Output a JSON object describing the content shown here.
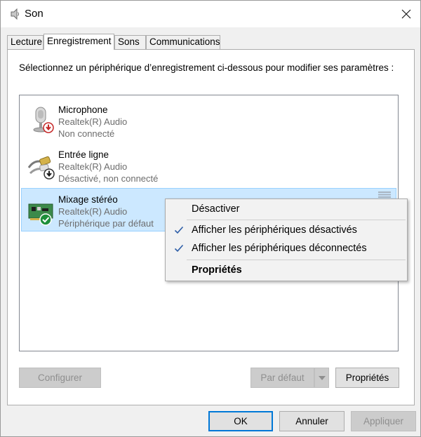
{
  "window": {
    "title": "Son",
    "icon": "speaker-icon",
    "close_icon": "close-icon"
  },
  "tabs": [
    {
      "label": "Lecture"
    },
    {
      "label": "Enregistrement",
      "active": true
    },
    {
      "label": "Sons"
    },
    {
      "label": "Communications"
    }
  ],
  "panel": {
    "instruction": "Sélectionnez un périphérique d’enregistrement ci-dessous pour modifier ses paramètres :"
  },
  "devices": [
    {
      "name": "Microphone",
      "driver": "Realtek(R) Audio",
      "status": "Non connecté",
      "icon": "microphone-icon",
      "badge": "disconnected-badge-icon"
    },
    {
      "name": "Entrée ligne",
      "driver": "Realtek(R) Audio",
      "status": "Désactivé, non connecté",
      "icon": "line-in-jack-icon",
      "badge": "disabled-badge-icon"
    },
    {
      "name": "Mixage stéréo",
      "driver": "Realtek(R) Audio",
      "status": "Périphérique par défaut",
      "icon": "sound-card-icon",
      "badge": "default-check-badge-icon",
      "selected": true
    }
  ],
  "context_menu": {
    "items": [
      {
        "label": "Désactiver",
        "checked": false,
        "bold": false
      },
      {
        "label": "Afficher les périphériques désactivés",
        "checked": true,
        "bold": false
      },
      {
        "label": "Afficher les périphériques déconnectés",
        "checked": true,
        "bold": false
      },
      {
        "label": "Propriétés",
        "checked": false,
        "bold": true
      }
    ]
  },
  "panel_buttons": {
    "configure": "Configurer",
    "set_default": "Par défaut",
    "properties": "Propriétés"
  },
  "dialog_buttons": {
    "ok": "OK",
    "cancel": "Annuler",
    "apply": "Appliquer"
  },
  "colors": {
    "selection_bg": "#cce8ff",
    "selection_border": "#99d1ff",
    "accent": "#0078d7",
    "check": "#2f5fa8",
    "muted_text": "#6d6d6d"
  }
}
